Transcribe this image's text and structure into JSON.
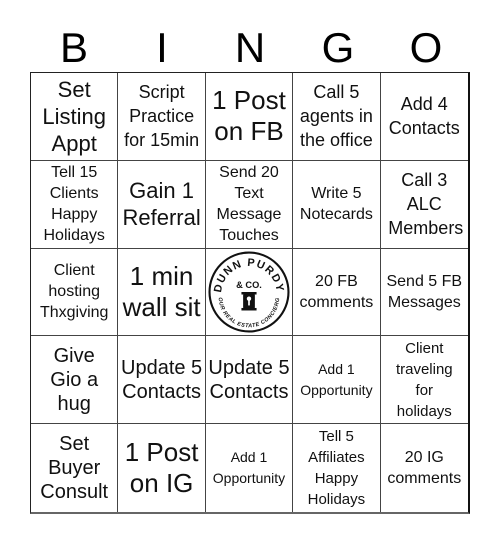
{
  "header": {
    "letters": [
      "B",
      "I",
      "N",
      "G",
      "O"
    ]
  },
  "cells": [
    {
      "text": "Set Listing Appt"
    },
    {
      "text": "Script Practice for 15min"
    },
    {
      "text": "1 Post on FB"
    },
    {
      "text": "Call 5 agents in the office"
    },
    {
      "text": "Add 4 Contacts"
    },
    {
      "text": "Tell 15 Clients Happy Holidays"
    },
    {
      "text": "Gain 1 Referral"
    },
    {
      "text": "Send 20 Text Message Touches"
    },
    {
      "text": "Write 5 Notecards"
    },
    {
      "text": "Call 3 ALC Members"
    },
    {
      "text": "Client hosting Thxgiving"
    },
    {
      "text": "1 min wall sit"
    },
    {
      "free": true
    },
    {
      "text": "20 FB comments"
    },
    {
      "text": "Send 5 FB Messages"
    },
    {
      "text": "Give Gio a hug"
    },
    {
      "text": "Update 5 Contacts"
    },
    {
      "text": "Update 5 Contacts"
    },
    {
      "text": "Add 1 Opportunity"
    },
    {
      "text": "Client traveling for holidays"
    },
    {
      "text": "Set Buyer Consult"
    },
    {
      "text": "1 Post on IG"
    },
    {
      "text": "Add 1 Opportunity"
    },
    {
      "text": "Tell 5 Affiliates Happy Holidays"
    },
    {
      "text": "20 IG comments"
    }
  ],
  "free_space": {
    "logo_top_text": "DUNN PURDY",
    "logo_middle_text": "& CO.",
    "logo_bottom_text": "YOUR REAL ESTATE CONCIERGE",
    "icon": "keyhole-icon"
  }
}
